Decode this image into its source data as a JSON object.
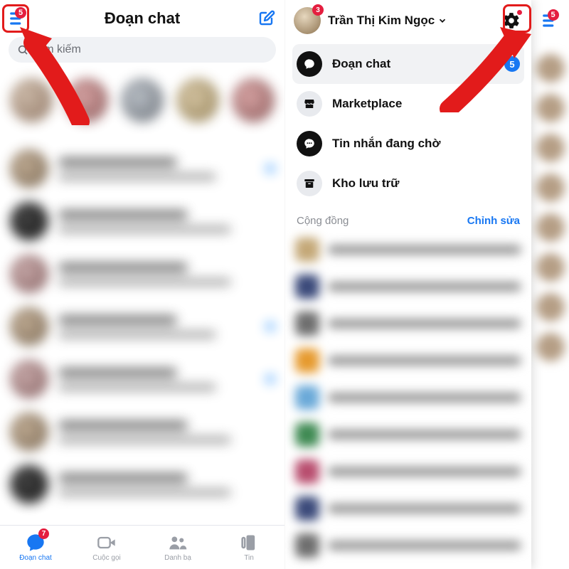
{
  "left": {
    "menu_badge": "5",
    "title": "Đoạn chat",
    "search_placeholder": "Tìm kiếm",
    "tabs": {
      "chats": {
        "label": "Đoạn chat",
        "badge": "7"
      },
      "calls": {
        "label": "Cuộc gọi"
      },
      "contacts": {
        "label": "Danh bạ"
      },
      "stories": {
        "label": "Tin"
      }
    }
  },
  "right": {
    "underlay_menu_badge": "5",
    "avatar_badge": "3",
    "username": "Trần Thị Kim Ngọc",
    "menu": {
      "chats": {
        "label": "Đoạn chat",
        "badge": "5"
      },
      "marketplace": {
        "label": "Marketplace"
      },
      "requests": {
        "label": "Tin nhắn đang chờ"
      },
      "archive": {
        "label": "Kho lưu trữ"
      }
    },
    "community": {
      "title": "Cộng đồng",
      "edit": "Chỉnh sửa"
    }
  },
  "colors": {
    "accent": "#1877f2",
    "danger": "#e41e3f",
    "highlight": "#e21b1b"
  }
}
